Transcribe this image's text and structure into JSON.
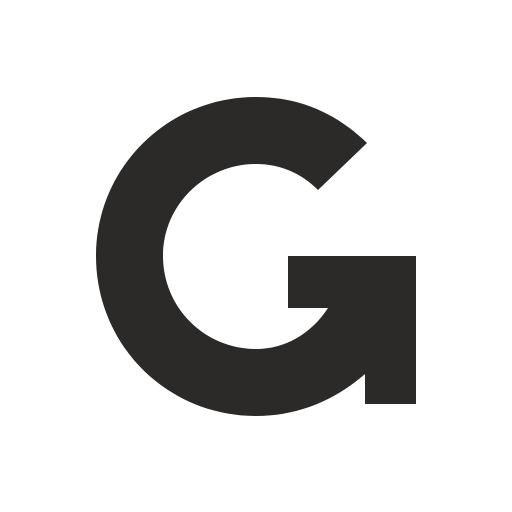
{
  "logo": {
    "icon": "g-logo-icon",
    "glyph": "G",
    "color": "#2b2a29",
    "background": "#ffffff"
  }
}
